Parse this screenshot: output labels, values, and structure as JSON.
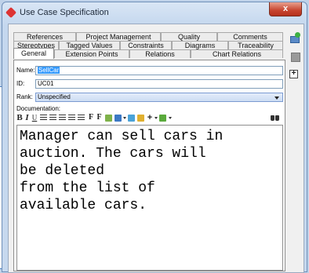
{
  "window": {
    "title": "Use Case Specification",
    "close_label": "x"
  },
  "tabs": {
    "row1": [
      "References",
      "Project Management",
      "Quality",
      "Comments"
    ],
    "row2": [
      "Stereotypes",
      "Tagged Values",
      "Constraints",
      "Diagrams",
      "Traceability"
    ],
    "row3": [
      "General",
      "Extension Points",
      "Relations",
      "Chart Relations"
    ],
    "active": "General"
  },
  "form": {
    "name_label": "Name:",
    "name_value": "SellCar",
    "id_label": "ID:",
    "id_value": "UC01",
    "rank_label": "Rank:",
    "rank_value": "Unspecified",
    "documentation_label": "Documentation:"
  },
  "toolbar": {
    "bold": "B",
    "italic": "I",
    "underline": "U",
    "font": "F",
    "font_size": "F",
    "plus": "+"
  },
  "documentation_text": "Manager can sell cars in\nauction. The cars will\nbe deleted\nfrom the list of\navailable cars.",
  "side_tools": {
    "expand": "+"
  },
  "colors": {
    "selection": "#3399ff",
    "close_button": "#c7452f",
    "window_frame": "#c6d8ee"
  }
}
